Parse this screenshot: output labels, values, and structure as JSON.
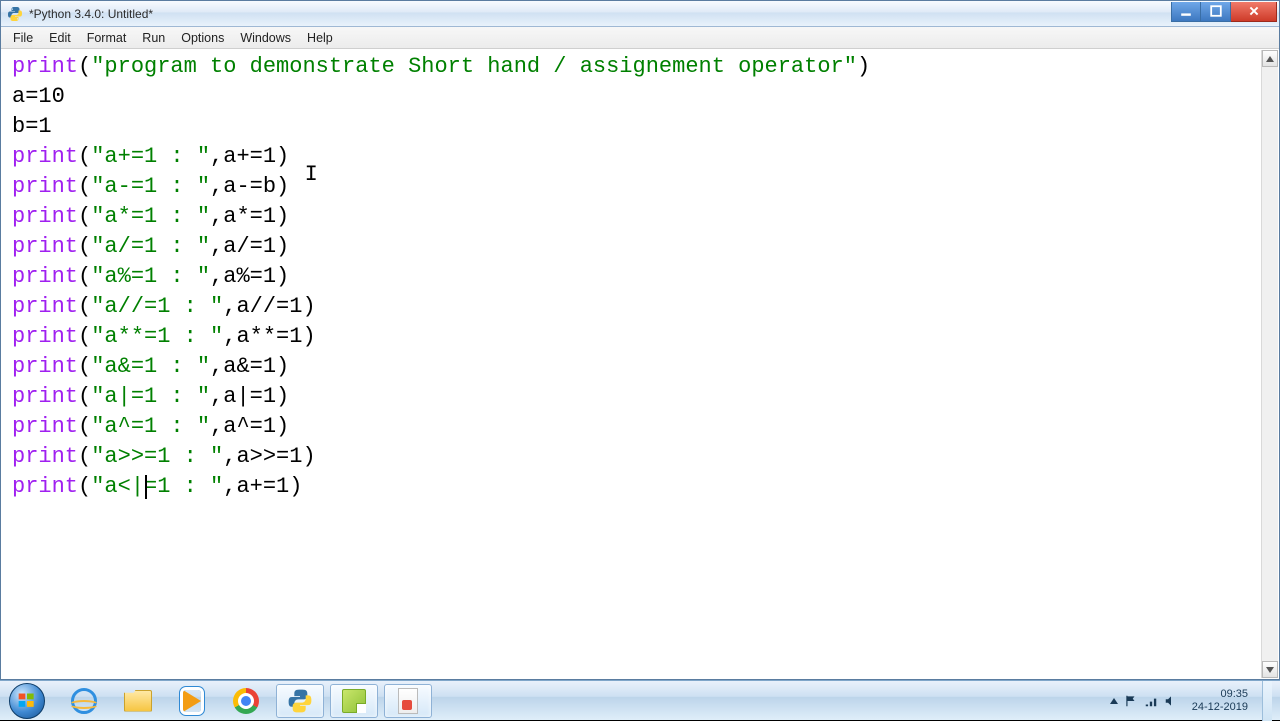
{
  "window": {
    "title": "*Python 3.4.0: Untitled*"
  },
  "menubar": {
    "items": [
      "File",
      "Edit",
      "Format",
      "Run",
      "Options",
      "Windows",
      "Help"
    ]
  },
  "code": {
    "lines": [
      {
        "type": "print",
        "kw": "print",
        "p_open": "(",
        "str": "\"program to demonstrate Short hand / assignement operator\"",
        "rest": ")",
        "tail": ""
      },
      {
        "type": "plain",
        "text": "a=10"
      },
      {
        "type": "plain",
        "text": "b=1"
      },
      {
        "type": "print",
        "kw": "print",
        "p_open": "(",
        "str": "\"a+=1 : \"",
        "rest": ",a+=1)"
      },
      {
        "type": "print",
        "kw": "print",
        "p_open": "(",
        "str": "\"a-=1 : \"",
        "rest": ",a-=b)"
      },
      {
        "type": "print",
        "kw": "print",
        "p_open": "(",
        "str": "\"a*=1 : \"",
        "rest": ",a*=1)"
      },
      {
        "type": "print",
        "kw": "print",
        "p_open": "(",
        "str": "\"a/=1 : \"",
        "rest": ",a/=1)"
      },
      {
        "type": "print",
        "kw": "print",
        "p_open": "(",
        "str": "\"a%=1 : \"",
        "rest": ",a%=1)"
      },
      {
        "type": "print",
        "kw": "print",
        "p_open": "(",
        "str": "\"a//=1 : \"",
        "rest": ",a//=1)"
      },
      {
        "type": "print",
        "kw": "print",
        "p_open": "(",
        "str": "\"a**=1 : \"",
        "rest": ",a**=1)"
      },
      {
        "type": "print",
        "kw": "print",
        "p_open": "(",
        "str": "\"a&=1 : \"",
        "rest": ",a&=1)"
      },
      {
        "type": "print",
        "kw": "print",
        "p_open": "(",
        "str": "\"a|=1 : \"",
        "rest": ",a|=1)"
      },
      {
        "type": "print",
        "kw": "print",
        "p_open": "(",
        "str": "\"a^=1 : \"",
        "rest": ",a^=1)"
      },
      {
        "type": "print",
        "kw": "print",
        "p_open": "(",
        "str": "\"a>>=1 : \"",
        "rest": ",a>>=1)"
      },
      {
        "type": "print",
        "kw": "print",
        "p_open": "(",
        "str": "\"a<|=1 : \"",
        "rest": ",a+=1)"
      }
    ],
    "caret": {
      "line": 14,
      "col": 10
    },
    "text_cursor_overlay": {
      "line": 4,
      "col": 22,
      "glyph": "I"
    }
  },
  "taskbar": {
    "pinned": [
      {
        "name": "internet-explorer"
      },
      {
        "name": "file-explorer"
      },
      {
        "name": "media-player"
      },
      {
        "name": "chrome"
      },
      {
        "name": "python-idle",
        "active": true
      },
      {
        "name": "sticky-notes",
        "active": true
      },
      {
        "name": "screen-recorder",
        "active": true
      }
    ],
    "clock": {
      "time": "09:35",
      "date": "24-12-2019"
    }
  }
}
